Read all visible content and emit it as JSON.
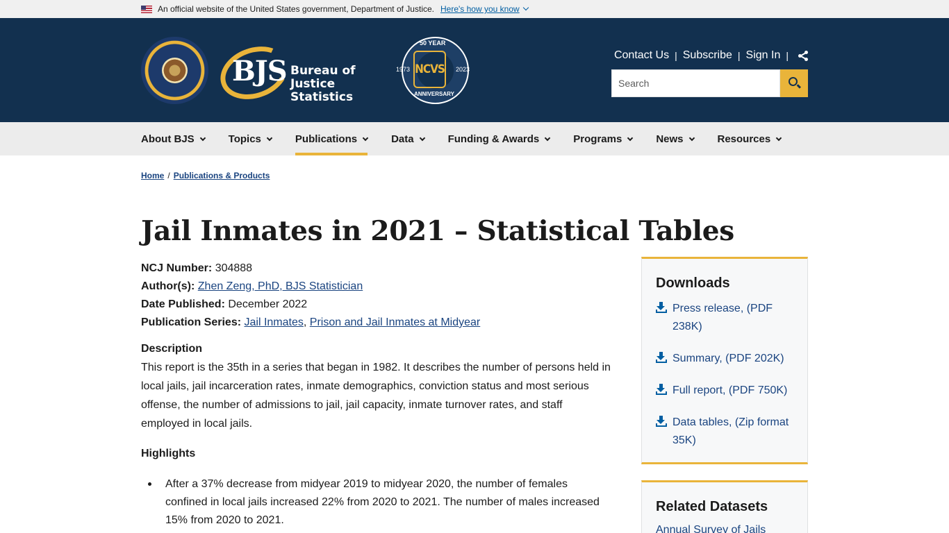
{
  "gov_banner": {
    "text": "An official website of the United States government, Department of Justice.",
    "link": "Here's how you know"
  },
  "header": {
    "seal_alt": "Office of Justice Programs seal",
    "logo_abbr": "BJS",
    "logo_name_line1": "Bureau of",
    "logo_name_line2": "Justice Statistics",
    "ncvs": {
      "top": "50 YEAR",
      "label": "NCVS",
      "year_start": "1973",
      "year_end": "2023",
      "bottom": "ANNIVERSARY"
    },
    "utility": {
      "contact": "Contact Us",
      "subscribe": "Subscribe",
      "signin": "Sign In",
      "sep": "|"
    },
    "search": {
      "placeholder": "Search",
      "value": ""
    }
  },
  "nav": {
    "items": [
      {
        "label": "About BJS"
      },
      {
        "label": "Topics"
      },
      {
        "label": "Publications"
      },
      {
        "label": "Data"
      },
      {
        "label": "Funding & Awards"
      },
      {
        "label": "Programs"
      },
      {
        "label": "News"
      },
      {
        "label": "Resources"
      }
    ],
    "active": "Publications"
  },
  "breadcrumb": {
    "home": "Home",
    "sep": "/",
    "current": "Publications & Products"
  },
  "page": {
    "title": "Jail Inmates in 2021 – Statistical Tables",
    "meta": {
      "ncj_label": "NCJ Number:",
      "ncj_value": "304888",
      "author_label": "Author(s):",
      "author_value": "Zhen Zeng, PhD, BJS Statistician",
      "date_label": "Date Published:",
      "date_value": "December 2022",
      "series_label": "Publication Series:",
      "series_1": "Jail Inmates",
      "series_sep": ",",
      "series_2": "Prison and Jail Inmates at Midyear"
    },
    "description_heading": "Description",
    "description": "This report is the 35th in a series that began in 1982. It describes the number of persons held in local jails, jail incarceration rates, inmate demographics, conviction status and most serious offense, the number of admissions to jail, jail capacity, inmate turnover rates, and staff employed in local jails.",
    "highlights_heading": "Highlights",
    "highlights": [
      "After a 37% decrease from midyear 2019 to midyear 2020, the number of females confined in local jails increased 22% from 2020 to 2021. The number of males increased 15% from 2020 to 2021."
    ]
  },
  "sidebar": {
    "downloads_heading": "Downloads",
    "downloads": [
      {
        "label": "Press release, (PDF 238K)"
      },
      {
        "label": "Summary, (PDF 202K)"
      },
      {
        "label": "Full report, (PDF 750K)"
      },
      {
        "label": "Data tables, (Zip format 35K)"
      }
    ],
    "related_heading": "Related Datasets",
    "related_first": "Annual Survey of Jails"
  },
  "colors": {
    "header_bg": "#12304f",
    "accent": "#e9b43a",
    "link": "#1a4480",
    "nav_bg": "#ececec"
  }
}
